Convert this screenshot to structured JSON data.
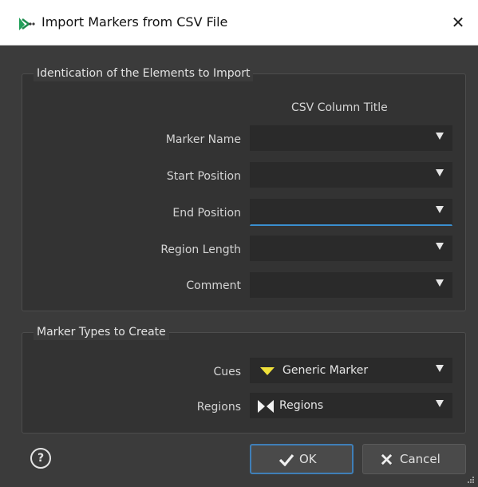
{
  "window": {
    "title": "Import Markers from CSV File",
    "close_glyph": "✕"
  },
  "identification": {
    "title": "Identication of the Elements to Import",
    "column_title": "CSV Column Title",
    "rows": [
      {
        "label": "Marker Name",
        "value": ""
      },
      {
        "label": "Start Position",
        "value": ""
      },
      {
        "label": "End Position",
        "value": ""
      },
      {
        "label": "Region Length",
        "value": ""
      },
      {
        "label": "Comment",
        "value": ""
      }
    ]
  },
  "marker_types": {
    "title": "Marker Types to Create",
    "cues": {
      "label": "Cues",
      "value": "Generic Marker",
      "icon": "yellow-marker-triangle-icon",
      "icon_color": "#f0e13a"
    },
    "regions": {
      "label": "Regions",
      "value": "Regions",
      "icon": "region-bowtie-icon"
    }
  },
  "footer": {
    "help_glyph": "?",
    "ok_label": "OK",
    "cancel_label": "Cancel",
    "ok_icon": "checkmark-icon",
    "cancel_icon": "x-icon"
  },
  "colors": {
    "dialog_bg": "#3b3b3b",
    "focus_accent": "#3a8fd0",
    "marker_yellow": "#f0e13a"
  }
}
